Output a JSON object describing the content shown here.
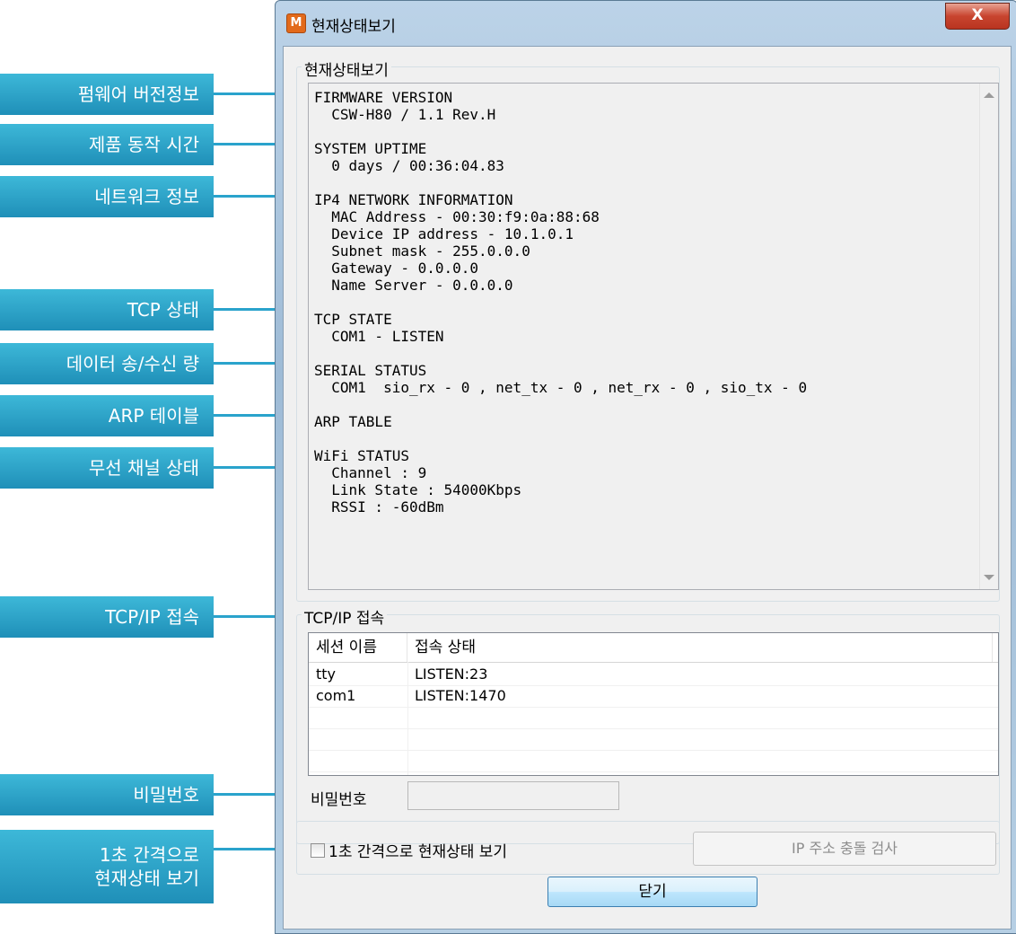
{
  "window": {
    "title": "현재상태보기",
    "app_icon": "M",
    "close_glyph": "X"
  },
  "status_group": {
    "label": "현재상태보기",
    "text": "FIRMWARE VERSION\n  CSW-H80 / 1.1 Rev.H\n\nSYSTEM UPTIME\n  0 days / 00:36:04.83\n\nIP4 NETWORK INFORMATION\n  MAC Address - 00:30:f9:0a:88:68\n  Device IP address - 10.1.0.1\n  Subnet mask - 255.0.0.0\n  Gateway - 0.0.0.0\n  Name Server - 0.0.0.0\n\nTCP STATE\n  COM1 - LISTEN\n\nSERIAL STATUS\n  COM1  sio_rx - 0 , net_tx - 0 , net_rx - 0 , sio_tx - 0\n\nARP TABLE\n\nWiFi STATUS\n  Channel : 9\n  Link State : 54000Kbps\n  RSSI : -60dBm"
  },
  "tcp_group": {
    "label": "TCP/IP 접속",
    "columns": [
      "세션 이름",
      "접속 상태"
    ],
    "rows": [
      {
        "session": "tty",
        "state": "LISTEN:23"
      },
      {
        "session": "com1",
        "state": "LISTEN:1470"
      }
    ]
  },
  "password": {
    "label": "비밀번호",
    "value": ""
  },
  "options": {
    "auto_refresh_label": "1초 간격으로 현재상태 보기",
    "auto_refresh_checked": false,
    "ip_conflict_button": "IP 주소 충돌 검사",
    "close_button": "닫기"
  },
  "callouts": [
    {
      "label": "펌웨어 버전정보"
    },
    {
      "label": "제품 동작 시간"
    },
    {
      "label": "네트워크 정보"
    },
    {
      "label": "TCP 상태"
    },
    {
      "label": "데이터 송/수신 량"
    },
    {
      "label": "ARP 테이블"
    },
    {
      "label": "무선 채널 상태"
    },
    {
      "label": "TCP/IP 접속"
    },
    {
      "label": "비밀번호"
    },
    {
      "label": "1초 간격으로\n현재상태 보기"
    }
  ],
  "colors": {
    "callout_bg": "#2aa3cc",
    "close_button": "#c8452f"
  }
}
